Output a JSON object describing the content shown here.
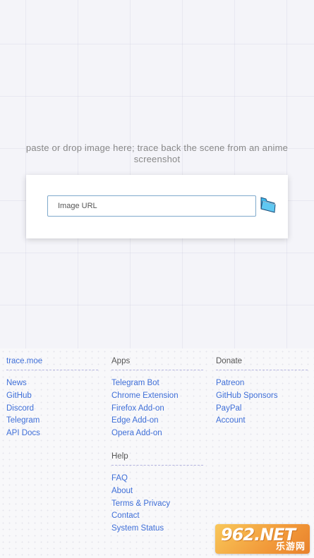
{
  "hero": {
    "text": "paste or drop image here; trace back the scene from an anime screenshot"
  },
  "search": {
    "placeholder": "Image URL",
    "value": "",
    "browse_icon": "folder-icon",
    "browse_icon_color": "#29a8e0"
  },
  "footer": {
    "columns": [
      {
        "heading": "trace.moe",
        "heading_is_link": true,
        "links": [
          "News",
          "GitHub",
          "Discord",
          "Telegram",
          "API Docs"
        ]
      },
      {
        "heading": "Apps",
        "links": [
          "Telegram Bot",
          "Chrome Extension",
          "Firefox Add-on",
          "Edge Add-on",
          "Opera Add-on"
        ]
      },
      {
        "heading": "Donate",
        "links": [
          "Patreon",
          "GitHub Sponsors",
          "PayPal",
          "Account"
        ]
      },
      {
        "heading": "Help",
        "links": [
          "FAQ",
          "About",
          "Terms & Privacy",
          "Contact",
          "System Status"
        ]
      }
    ]
  },
  "watermark": {
    "main": "962.NET",
    "sub": "乐游网"
  },
  "colors": {
    "link": "#3f6fd8",
    "background": "#f4f4f9",
    "input_border": "#7fa9cc"
  }
}
